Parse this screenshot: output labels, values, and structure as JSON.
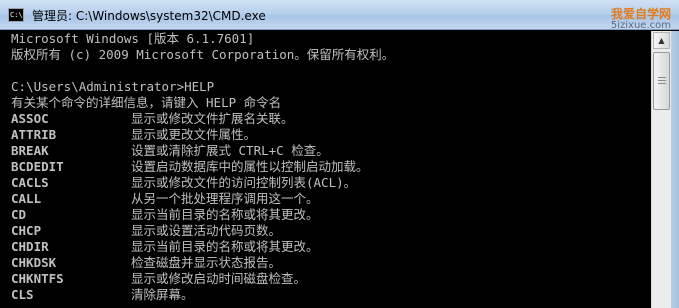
{
  "window": {
    "title": "管理员: C:\\Windows\\system32\\CMD.exe",
    "icon_text": "C:\\",
    "buttons": {
      "minimize": "—",
      "maximize": "□",
      "close": "✕"
    },
    "watermark": {
      "line1": "我爱自学网",
      "line2": "5izixue.com"
    }
  },
  "console": {
    "header_lines": [
      "Microsoft Windows [版本 6.1.7601]",
      "版权所有 (c) 2009 Microsoft Corporation。保留所有权利。",
      "",
      "C:\\Users\\Administrator>HELP",
      "有关某个命令的详细信息，请键入 HELP 命令名"
    ],
    "commands": [
      {
        "name": "ASSOC",
        "desc": "显示或修改文件扩展名关联。"
      },
      {
        "name": "ATTRIB",
        "desc": "显示或更改文件属性。"
      },
      {
        "name": "BREAK",
        "desc": "设置或清除扩展式 CTRL+C 检查。"
      },
      {
        "name": "BCDEDIT",
        "desc": "设置启动数据库中的属性以控制启动加载。"
      },
      {
        "name": "CACLS",
        "desc": "显示或修改文件的访问控制列表(ACL)。"
      },
      {
        "name": "CALL",
        "desc": "从另一个批处理程序调用这一个。"
      },
      {
        "name": "CD",
        "desc": "显示当前目录的名称或将其更改。"
      },
      {
        "name": "CHCP",
        "desc": "显示或设置活动代码页数。"
      },
      {
        "name": "CHDIR",
        "desc": "显示当前目录的名称或将其更改。"
      },
      {
        "name": "CHKDSK",
        "desc": "检查磁盘并显示状态报告。"
      },
      {
        "name": "CHKNTFS",
        "desc": "显示或修改启动时间磁盘检查。"
      },
      {
        "name": "CLS",
        "desc": "清除屏幕。"
      }
    ]
  },
  "colors": {
    "console_bg": "#000000",
    "console_fg": "#c0c0c0",
    "titlebar": "#b8d0ec"
  }
}
